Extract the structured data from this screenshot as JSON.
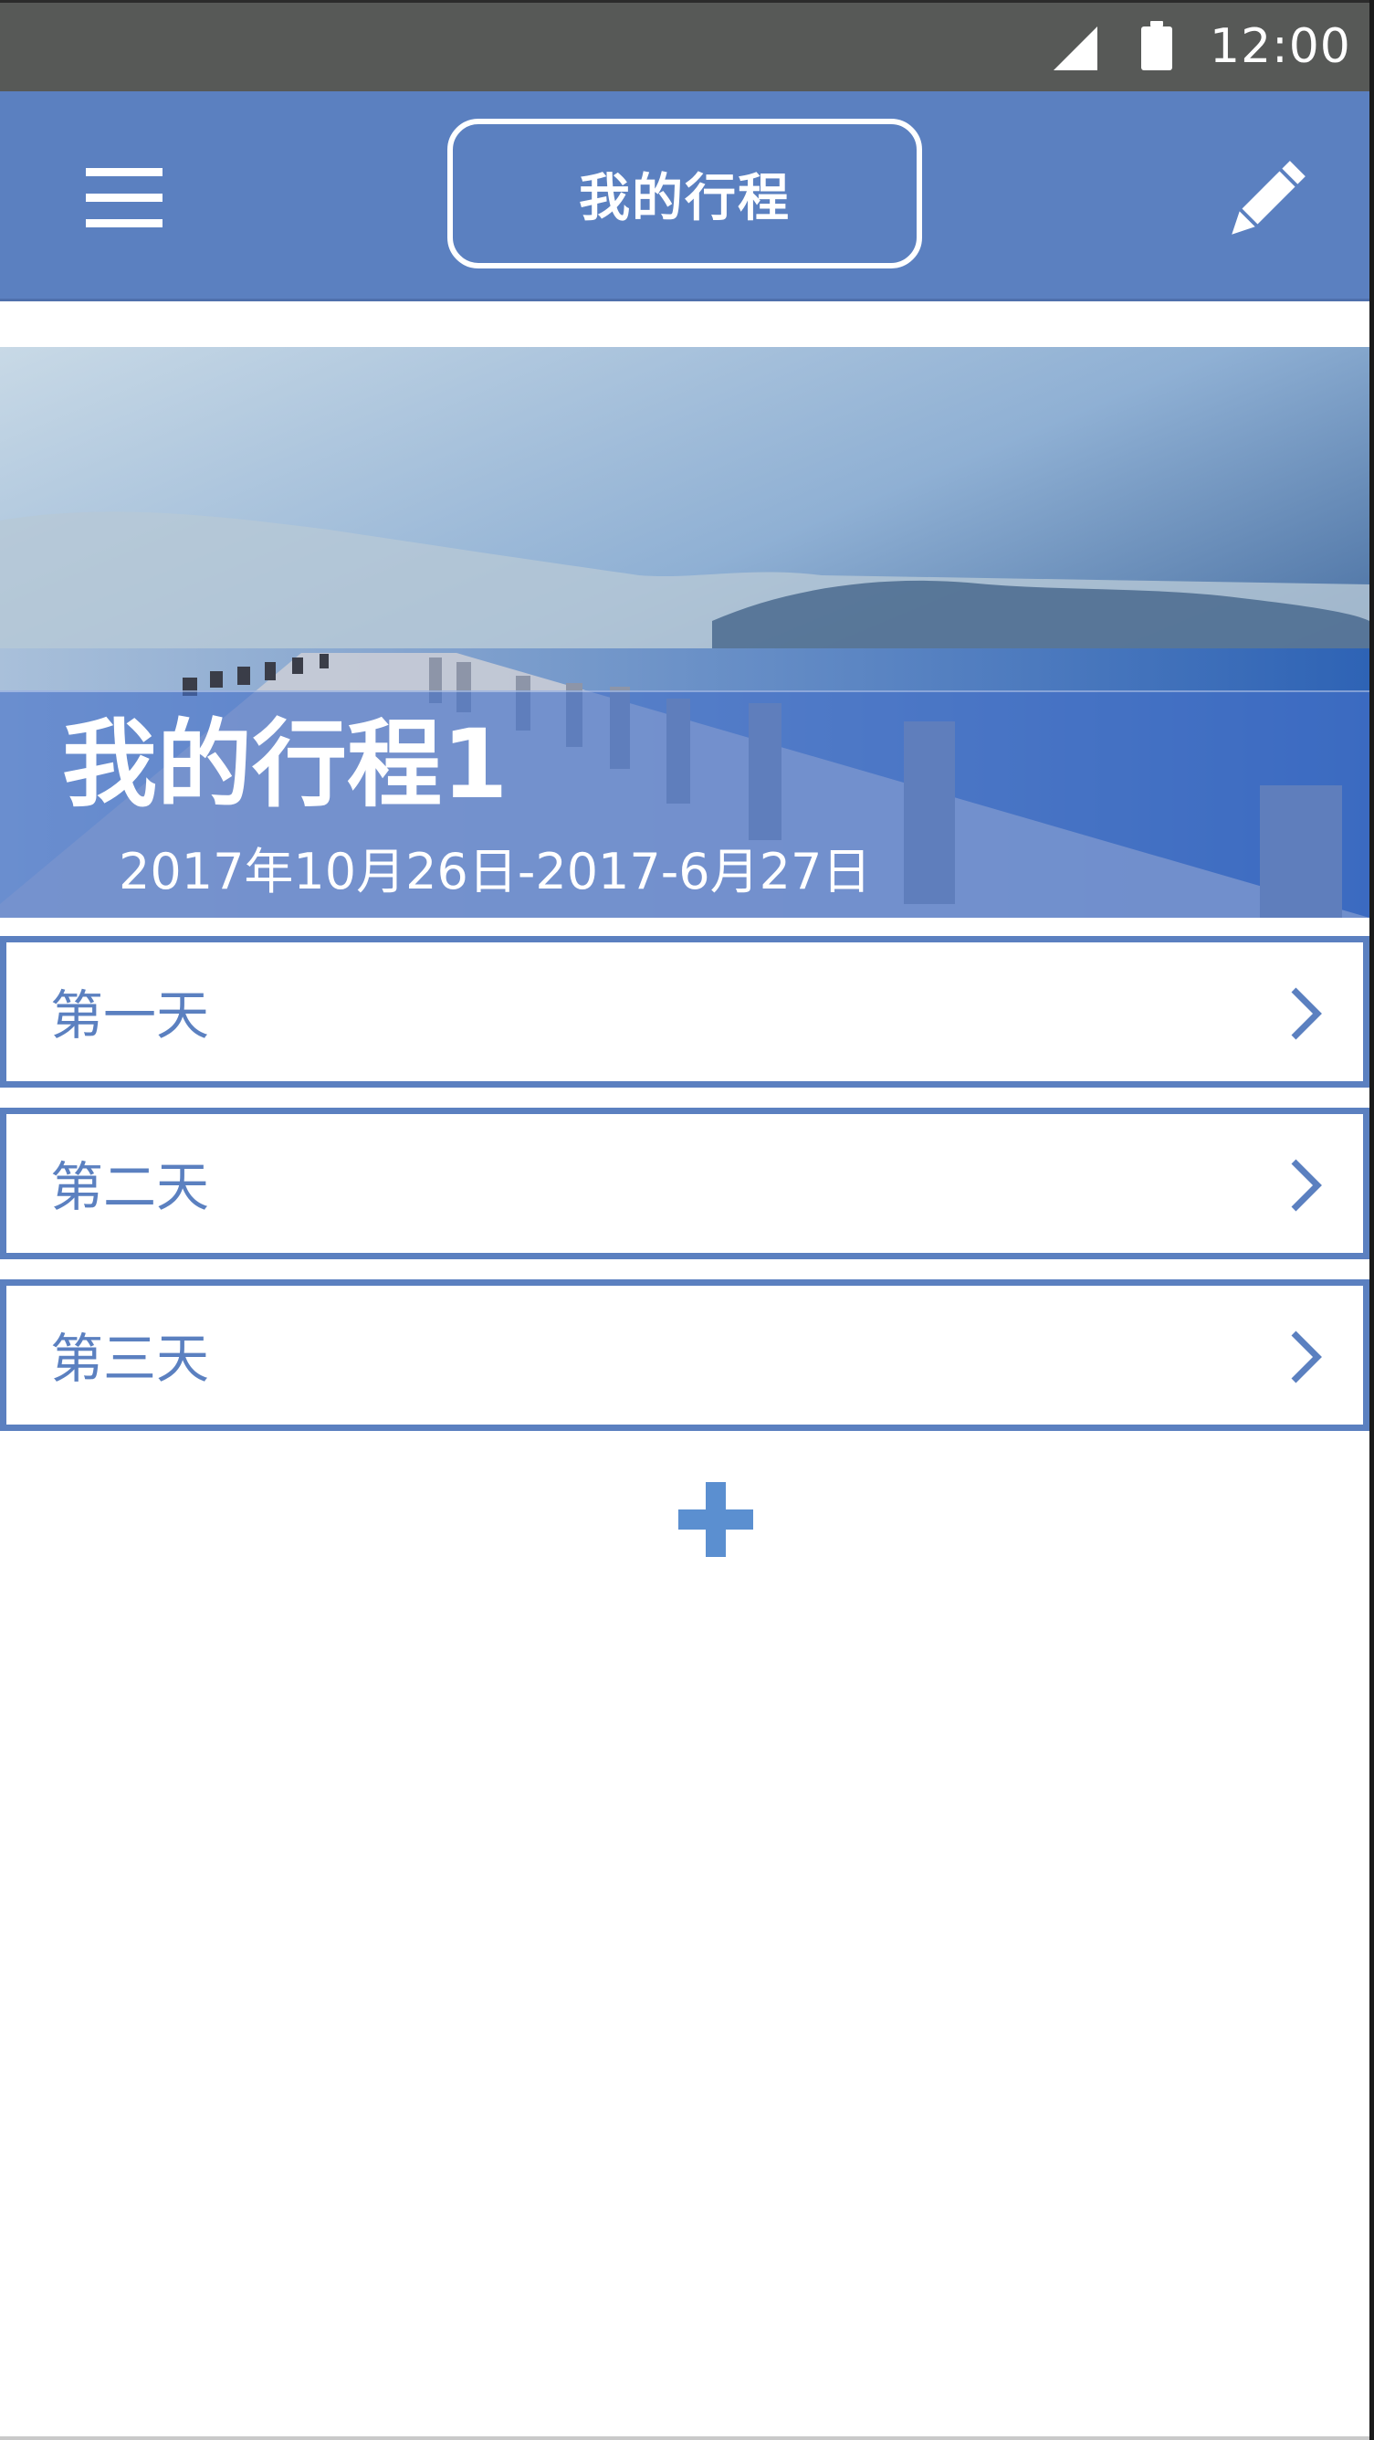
{
  "status_bar": {
    "time": "12:00",
    "icons": [
      "signal-icon",
      "battery-icon"
    ]
  },
  "app_bar": {
    "title": "我的行程",
    "left_icon": "hamburger-menu-icon",
    "right_icon": "pencil-icon",
    "color": "#5b80c0"
  },
  "trip": {
    "title": "我的行程1",
    "dates": "2017年10月26日-2017-6月27日"
  },
  "days": [
    {
      "label": "第一天"
    },
    {
      "label": "第二天"
    },
    {
      "label": "第三天"
    }
  ],
  "add_button": {
    "icon": "plus-icon",
    "color": "#5b8fd0"
  }
}
